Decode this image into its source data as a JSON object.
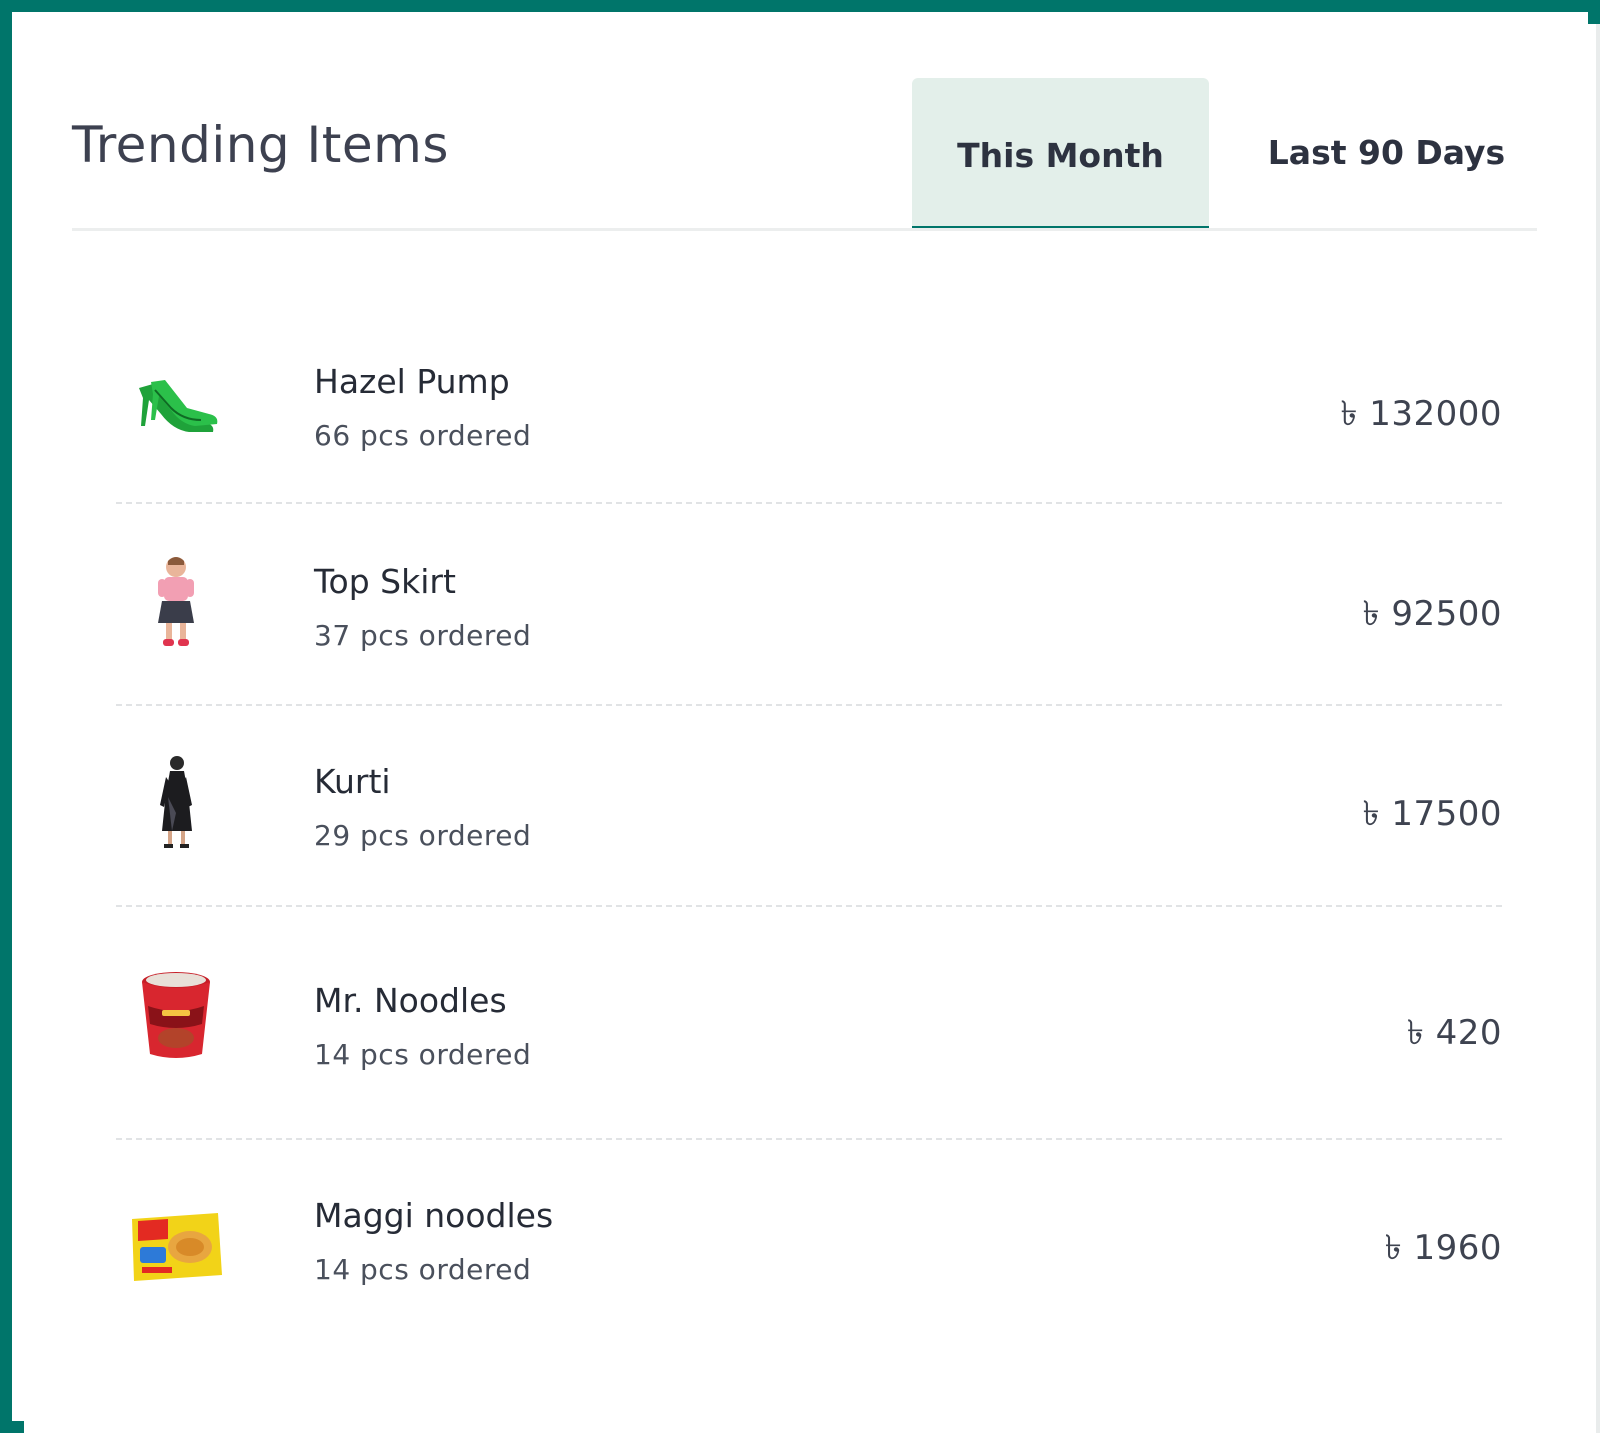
{
  "header": {
    "title": "Trending Items",
    "tabs": [
      {
        "label": "This Month",
        "active": true
      },
      {
        "label": "Last 90 Days",
        "active": false
      }
    ]
  },
  "theme": {
    "accent": "#00756a",
    "active_tab_bg": "#e3efea"
  },
  "items": [
    {
      "name": "Hazel Pump",
      "ordered": "66 pcs ordered",
      "price": "৳ 132000",
      "icon": "green-pump-shoe-icon"
    },
    {
      "name": "Top Skirt",
      "ordered": "37 pcs ordered",
      "price": "৳ 92500",
      "icon": "child-top-skirt-icon"
    },
    {
      "name": "Kurti",
      "ordered": "29 pcs ordered",
      "price": "৳ 17500",
      "icon": "black-kurti-dress-icon"
    },
    {
      "name": "Mr. Noodles",
      "ordered": "14 pcs ordered",
      "price": "৳ 420",
      "icon": "noodle-cup-icon"
    },
    {
      "name": "Maggi noodles",
      "ordered": "14 pcs ordered",
      "price": "৳ 1960",
      "icon": "maggi-pack-icon"
    }
  ]
}
